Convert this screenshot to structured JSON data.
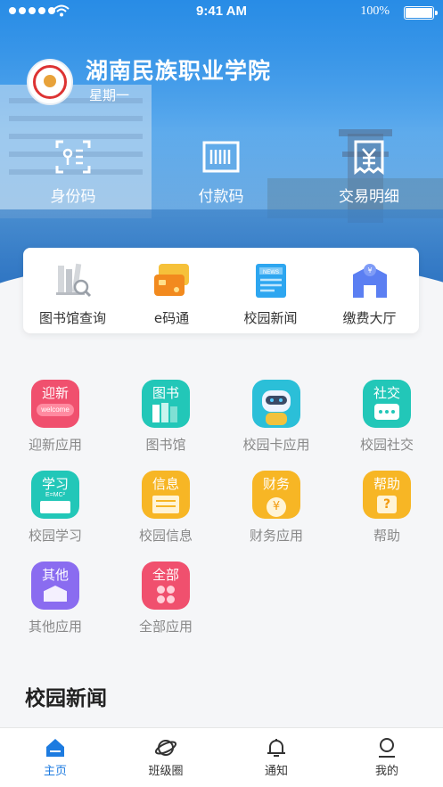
{
  "status_bar": {
    "time": "9:41 AM",
    "battery": "100%"
  },
  "header": {
    "school_name": "湖南民族职业学院",
    "weekday": "星期一"
  },
  "quick_actions": [
    {
      "label": "身份码",
      "icon": "id-code-icon"
    },
    {
      "label": "付款码",
      "icon": "barcode-icon"
    },
    {
      "label": "交易明细",
      "icon": "receipt-yen-icon"
    }
  ],
  "service_card": [
    {
      "label": "图书馆查询",
      "icon": "library-search-icon"
    },
    {
      "label": "e码通",
      "icon": "cards-icon"
    },
    {
      "label": "校园新闻",
      "icon": "news-icon"
    },
    {
      "label": "缴费大厅",
      "icon": "payment-hall-icon"
    }
  ],
  "apps": [
    {
      "label": "迎新应用",
      "badge": "迎新",
      "sub": "welcome",
      "color": "#f0506e"
    },
    {
      "label": "图书馆",
      "badge": "图书",
      "color": "#22c7b8"
    },
    {
      "label": "校园卡应用",
      "badge": "",
      "color": "#2bbfd8"
    },
    {
      "label": "校园社交",
      "badge": "社交",
      "color": "#22c7b8"
    },
    {
      "label": "校园学习",
      "badge": "学习",
      "sub": "E=MC²",
      "color": "#22c7b8"
    },
    {
      "label": "校园信息",
      "badge": "信息",
      "color": "#f7b625"
    },
    {
      "label": "财务应用",
      "badge": "财务",
      "sub": "¥",
      "color": "#f7b625"
    },
    {
      "label": "帮助",
      "badge": "帮助",
      "sub": "?",
      "color": "#f7b625"
    },
    {
      "label": "其他应用",
      "badge": "其他",
      "color": "#8a6cf0"
    },
    {
      "label": "全部应用",
      "badge": "全部",
      "color": "#f0506e"
    }
  ],
  "news_section": {
    "title": "校园新闻"
  },
  "tabs": [
    {
      "label": "主页",
      "icon": "home-icon",
      "active": true
    },
    {
      "label": "班级圈",
      "icon": "planet-icon",
      "active": false
    },
    {
      "label": "通知",
      "icon": "bell-icon",
      "active": false
    },
    {
      "label": "我的",
      "icon": "profile-icon",
      "active": false
    }
  ]
}
